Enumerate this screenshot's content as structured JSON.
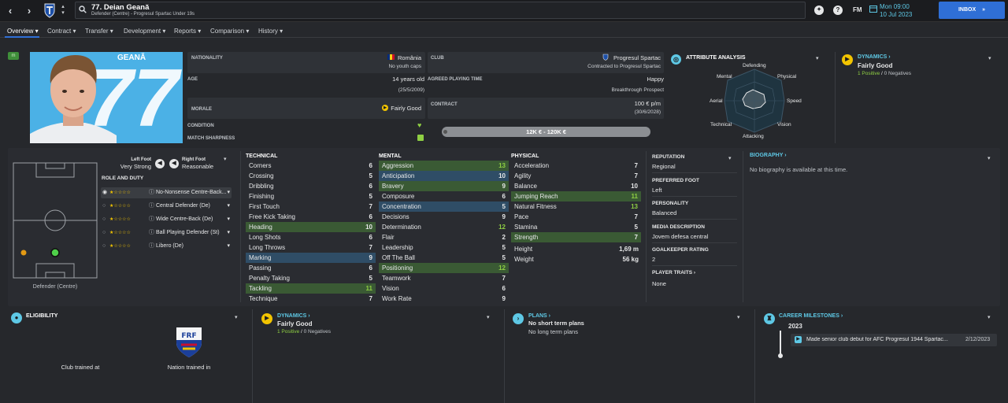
{
  "topbar": {
    "player_title": "77. Deian Geană",
    "player_subtitle": "Defender (Centre) - Progresul Spartac Under 19s",
    "fm_label": "FM",
    "date_day": "Mon 09:00",
    "date_full": "10 Jul 2023",
    "inbox_label": "INBOX"
  },
  "tabs": [
    {
      "label": "Overview"
    },
    {
      "label": "Contract"
    },
    {
      "label": "Transfer"
    },
    {
      "label": "Development"
    },
    {
      "label": "Reports"
    },
    {
      "label": "Comparison"
    },
    {
      "label": "History"
    }
  ],
  "profile": {
    "badge": "m",
    "shirt_name": "GEANĂ",
    "shirt_number": "77",
    "position_label": "Defender (Centre)"
  },
  "info": {
    "nationality_label": "NATIONALITY",
    "nationality_value": "România",
    "youth_caps": "No youth caps",
    "club_label": "CLUB",
    "club_value": "Progresul Spartac",
    "club_contract": "Contracted to Progresul Spartac",
    "age_label": "AGE",
    "age_value": "14 years old",
    "dob": "(25/5/2009)",
    "agreed_label": "AGREED PLAYING TIME",
    "agreed_value": "Happy",
    "agreed_sub": "Breakthrough Prospect",
    "morale_label": "MORALE",
    "morale_value": "Fairly Good",
    "contract_label": "CONTRACT",
    "contract_wage": "100 € p/m",
    "contract_end": "(30/6/2028)",
    "condition_label": "CONDITION",
    "sharpness_label": "MATCH SHARPNESS",
    "value_range": "12K € - 120K €"
  },
  "attribute_analysis": {
    "title": "ATTRIBUTE ANALYSIS",
    "axes": [
      "Defending",
      "Physical",
      "Speed",
      "Vision",
      "Attacking",
      "Technical",
      "Aerial",
      "Mental"
    ]
  },
  "dynamics_top": {
    "title": "DYNAMICS",
    "value": "Fairly Good",
    "positives": "1 Positive",
    "slash": "/",
    "negatives": "0 Negatives"
  },
  "feet": {
    "left_label": "Left Foot",
    "left_value": "Very Strong",
    "right_label": "Right Foot",
    "right_value": "Reasonable"
  },
  "roles": {
    "title": "ROLE AND DUTY",
    "items": [
      {
        "label": "No-Nonsense Centre-Back..."
      },
      {
        "label": "Central Defender (De)"
      },
      {
        "label": "Wide Centre-Back (De)"
      },
      {
        "label": "Ball Playing Defender (St)"
      },
      {
        "label": "Libero (De)"
      }
    ]
  },
  "technical": {
    "title": "TECHNICAL",
    "rows": [
      {
        "name": "Corners",
        "value": "6"
      },
      {
        "name": "Crossing",
        "value": "5"
      },
      {
        "name": "Dribbling",
        "value": "6"
      },
      {
        "name": "Finishing",
        "value": "5"
      },
      {
        "name": "First Touch",
        "value": "7"
      },
      {
        "name": "Free Kick Taking",
        "value": "6"
      },
      {
        "name": "Heading",
        "value": "10"
      },
      {
        "name": "Long Shots",
        "value": "6"
      },
      {
        "name": "Long Throws",
        "value": "7"
      },
      {
        "name": "Marking",
        "value": "9"
      },
      {
        "name": "Passing",
        "value": "6"
      },
      {
        "name": "Penalty Taking",
        "value": "5"
      },
      {
        "name": "Tackling",
        "value": "11"
      },
      {
        "name": "Technique",
        "value": "7"
      }
    ]
  },
  "mental": {
    "title": "MENTAL",
    "rows": [
      {
        "name": "Aggression",
        "value": "13"
      },
      {
        "name": "Anticipation",
        "value": "10"
      },
      {
        "name": "Bravery",
        "value": "9"
      },
      {
        "name": "Composure",
        "value": "6"
      },
      {
        "name": "Concentration",
        "value": "5"
      },
      {
        "name": "Decisions",
        "value": "9"
      },
      {
        "name": "Determination",
        "value": "12"
      },
      {
        "name": "Flair",
        "value": "2"
      },
      {
        "name": "Leadership",
        "value": "5"
      },
      {
        "name": "Off The Ball",
        "value": "5"
      },
      {
        "name": "Positioning",
        "value": "12"
      },
      {
        "name": "Teamwork",
        "value": "7"
      },
      {
        "name": "Vision",
        "value": "6"
      },
      {
        "name": "Work Rate",
        "value": "9"
      }
    ]
  },
  "physical": {
    "title": "PHYSICAL",
    "rows": [
      {
        "name": "Acceleration",
        "value": "7"
      },
      {
        "name": "Agility",
        "value": "7"
      },
      {
        "name": "Balance",
        "value": "10"
      },
      {
        "name": "Jumping Reach",
        "value": "11"
      },
      {
        "name": "Natural Fitness",
        "value": "13"
      },
      {
        "name": "Pace",
        "value": "7"
      },
      {
        "name": "Stamina",
        "value": "5"
      },
      {
        "name": "Strength",
        "value": "7"
      }
    ],
    "height_label": "Height",
    "height_value": "1,69 m",
    "weight_label": "Weight",
    "weight_value": "56 kg"
  },
  "details": {
    "reputation_label": "REPUTATION",
    "reputation_value": "Regional",
    "foot_label": "PREFERRED FOOT",
    "foot_value": "Left",
    "personality_label": "PERSONALITY",
    "personality_value": "Balanced",
    "media_label": "MEDIA DESCRIPTION",
    "media_value": "Jovem defesa central",
    "gk_label": "GOALKEEPER RATING",
    "gk_value": "2",
    "traits_label": "PLAYER TRAITS",
    "traits_value": "None"
  },
  "biography": {
    "title": "BIOGRAPHY",
    "text": "No biography is available at this time."
  },
  "eligibility": {
    "title": "ELIGIBILITY",
    "club_trained": "Club trained at",
    "nation_trained": "Nation trained in",
    "frf": "FRF"
  },
  "dynamics_bottom": {
    "title": "DYNAMICS",
    "value": "Fairly Good",
    "positives": "1 Positive",
    "slash": "/",
    "negatives": "0 Negatives"
  },
  "plans": {
    "title": "PLANS",
    "line1": "No short term plans",
    "line2": "No long term plans"
  },
  "milestones": {
    "title": "CAREER MILESTONES",
    "year": "2023",
    "item_text": "Made senior club debut for AFC Progresul 1944 Spartac...",
    "item_date": "2/12/2023"
  },
  "colors": {
    "accent_blue": "#2f6fd6",
    "attr_green": "#8fcf43",
    "link_cyan": "#5ec8e5",
    "morale_yellow": "#f2c400"
  }
}
